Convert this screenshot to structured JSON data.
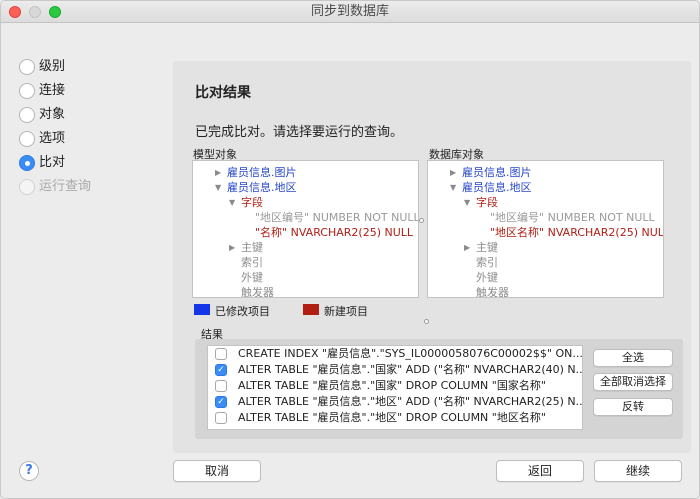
{
  "window": {
    "title": "同步到数据库"
  },
  "steps": [
    {
      "label": "级别",
      "state": "normal"
    },
    {
      "label": "连接",
      "state": "normal"
    },
    {
      "label": "对象",
      "state": "normal"
    },
    {
      "label": "选项",
      "state": "normal"
    },
    {
      "label": "比对",
      "state": "active"
    },
    {
      "label": "运行查询",
      "state": "disabled"
    }
  ],
  "panel": {
    "title": "比对结果",
    "message": "已完成比对。请选择要运行的查询。",
    "left_label": "模型对象",
    "right_label": "数据库对象",
    "left_tree": [
      {
        "text": "雇员信息.图片",
        "color": "blue",
        "arrow": "▶"
      },
      {
        "text": "雇员信息.地区",
        "color": "blue",
        "arrow": "▼"
      },
      {
        "text": "字段",
        "color": "red",
        "arrow": "▼"
      },
      {
        "text": "\"地区编号\" NUMBER NOT NULL",
        "color": "gray",
        "arrow": ""
      },
      {
        "text": "\"名称\" NVARCHAR2(25) NULL",
        "color": "red",
        "arrow": ""
      },
      {
        "text": "主键",
        "color": "dgray",
        "arrow": "▶"
      },
      {
        "text": "索引",
        "color": "dgray",
        "arrow": ""
      },
      {
        "text": "外键",
        "color": "dgray",
        "arrow": ""
      },
      {
        "text": "触发器",
        "color": "dgray",
        "arrow": ""
      }
    ],
    "right_tree": [
      {
        "text": "雇员信息.图片",
        "color": "blue",
        "arrow": "▶"
      },
      {
        "text": "雇员信息.地区",
        "color": "blue",
        "arrow": "▼"
      },
      {
        "text": "字段",
        "color": "red",
        "arrow": "▼"
      },
      {
        "text": "\"地区编号\" NUMBER NOT NULL",
        "color": "gray",
        "arrow": ""
      },
      {
        "text": "\"地区名称\" NVARCHAR2(25) NULL",
        "color": "red",
        "arrow": ""
      },
      {
        "text": "主键",
        "color": "dgray",
        "arrow": "▶"
      },
      {
        "text": "索引",
        "color": "dgray",
        "arrow": ""
      },
      {
        "text": "外键",
        "color": "dgray",
        "arrow": ""
      },
      {
        "text": "触发器",
        "color": "dgray",
        "arrow": ""
      }
    ],
    "legend": {
      "modified": {
        "label": "已修改项目",
        "color": "#1436e6"
      },
      "new": {
        "label": "新建项目",
        "color": "#b01e14"
      }
    },
    "results_label": "结果",
    "results": [
      {
        "text": "CREATE INDEX \"雇员信息\".\"SYS_IL0000058076C00002$$\" ON...",
        "checked": false
      },
      {
        "text": "ALTER TABLE \"雇员信息\".\"国家\" ADD (\"名称\" NVARCHAR2(40) N...",
        "checked": true
      },
      {
        "text": "ALTER TABLE \"雇员信息\".\"国家\" DROP COLUMN \"国家名称\"",
        "checked": false
      },
      {
        "text": "ALTER TABLE \"雇员信息\".\"地区\" ADD (\"名称\" NVARCHAR2(25) N...",
        "checked": true
      },
      {
        "text": "ALTER TABLE \"雇员信息\".\"地区\" DROP COLUMN \"地区名称\"",
        "checked": false
      }
    ],
    "buttons": {
      "select_all": "全选",
      "deselect_all": "全部取消选择",
      "invert": "反转"
    }
  },
  "footer": {
    "help": "?",
    "cancel": "取消",
    "back": "返回",
    "continue": "继续"
  },
  "icons": {
    "collapsed": "disclosure-right-icon",
    "expanded": "disclosure-down-icon"
  }
}
